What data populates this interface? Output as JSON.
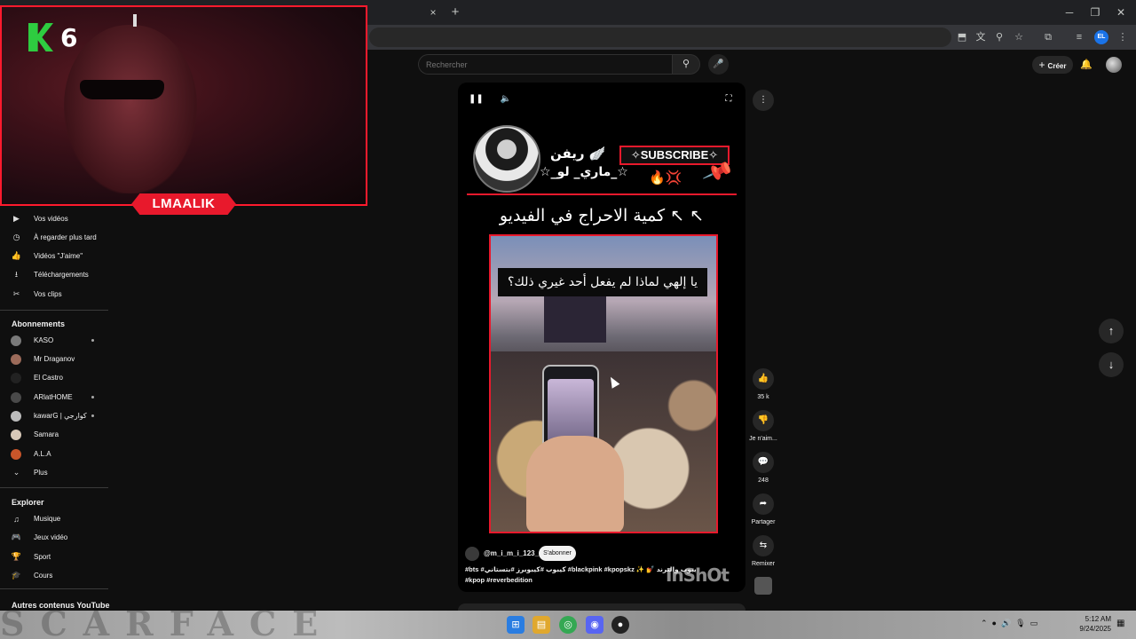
{
  "browser": {
    "close_tab": "×",
    "new_tab": "+",
    "minimize": "─",
    "restore": "❐",
    "close": "✕",
    "profile": "EL"
  },
  "header": {
    "search_placeholder": "Rechercher",
    "search_icon": "search-icon",
    "mic_icon": "mic-icon",
    "create_label": "Créer"
  },
  "sidebar": {
    "you_items": [
      {
        "label": "Vos vidéos",
        "icon": "▶"
      },
      {
        "label": "À regarder plus tard",
        "icon": "◷"
      },
      {
        "label": "Vidéos \"J'aime\"",
        "icon": "👍"
      },
      {
        "label": "Téléchargements",
        "icon": "⭳"
      },
      {
        "label": "Vos clips",
        "icon": "✂"
      }
    ],
    "subs_heading": "Abonnements",
    "subs": [
      {
        "label": "KASO",
        "color": "#7a7a7a",
        "dot": true
      },
      {
        "label": "Mr Draganov",
        "color": "#9c6b5a",
        "dot": false
      },
      {
        "label": "El Castro",
        "color": "#222222",
        "dot": false
      },
      {
        "label": "ARlatHOME",
        "color": "#4a4a4a",
        "dot": true
      },
      {
        "label": "kawarG | كوارجي",
        "color": "#bbbbbb",
        "dot": true
      },
      {
        "label": "Samara",
        "color": "#d8c8b8",
        "dot": false
      },
      {
        "label": "A.L.A",
        "color": "#c8552a",
        "dot": false
      }
    ],
    "more_label": "Plus",
    "explore_heading": "Explorer",
    "explore": [
      {
        "label": "Musique",
        "icon": "♫"
      },
      {
        "label": "Jeux vidéo",
        "icon": "🎮"
      },
      {
        "label": "Sport",
        "icon": "🏆"
      },
      {
        "label": "Cours",
        "icon": "🎓"
      }
    ],
    "other_heading": "Autres contenus YouTube"
  },
  "overlay": {
    "logo_number": "6",
    "name": "LMAALIK"
  },
  "short": {
    "channel_title_1": "ريفن 🪽",
    "channel_title_2": "☆_ماري_ لو_☆",
    "subscribe_badge": "✧SUBSCRIBE✧",
    "fire": "🔥💢",
    "pin": "📌",
    "caption": "كمية الاحراج في الفيديو ↖ ↖",
    "video_text": "يا إلهي لماذا لم يفعل أحد غيري ذلك؟",
    "author": "@m_i_m_i_123_2",
    "subscribe_label": "S'abonner",
    "desc_line1": "#bts #كيبوب #كيبوبرز #بتستاني #blackpink #kpopskz ✨ 💅 لمحبي الكيبوب والترند",
    "desc_line2": "#kpop #reverbedition",
    "watermark": "InShOt"
  },
  "rail": {
    "likes": "35 k",
    "dislike_label": "Je n'aim...",
    "comments": "248",
    "share_label": "Partager",
    "remix_label": "Remixer"
  },
  "taskbar": {
    "wallpaper": "SCARFACE",
    "time": "5:12 AM",
    "date": "9/24/2025"
  }
}
